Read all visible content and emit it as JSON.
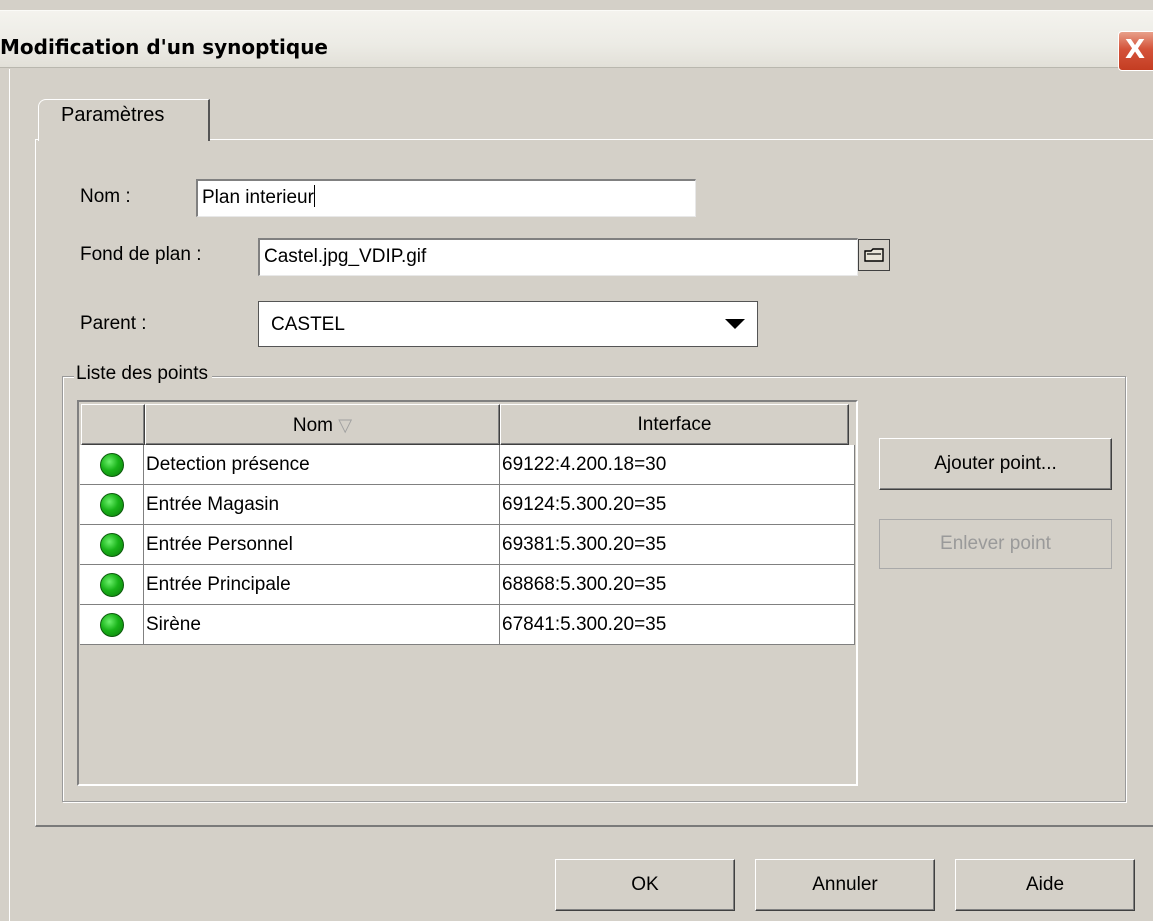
{
  "window": {
    "title": "Modification d'un synoptique",
    "close_glyph": "X"
  },
  "tabs": [
    {
      "label": "Paramètres",
      "selected": true
    }
  ],
  "form": {
    "nom_label": "Nom :",
    "nom_value": "Plan interieur",
    "fond_label": "Fond de plan :",
    "fond_value": "Castel.jpg_VDIP.gif",
    "parent_label": "Parent :",
    "parent_value": "CASTEL"
  },
  "points": {
    "group_title": "Liste des points",
    "columns": {
      "nom": "Nom",
      "sort_glyph": "▽",
      "interface": "Interface"
    },
    "rows": [
      {
        "status": "green",
        "nom": "Detection présence",
        "interface": "69122:4.200.18=30"
      },
      {
        "status": "green",
        "nom": "Entrée Magasin",
        "interface": "69124:5.300.20=35"
      },
      {
        "status": "green",
        "nom": "Entrée Personnel",
        "interface": "69381:5.300.20=35"
      },
      {
        "status": "green",
        "nom": "Entrée Principale",
        "interface": "68868:5.300.20=35"
      },
      {
        "status": "green",
        "nom": "Sirène",
        "interface": "67841:5.300.20=35"
      }
    ],
    "add_button": "Ajouter point...",
    "remove_button": "Enlever point"
  },
  "footer": {
    "ok": "OK",
    "cancel": "Annuler",
    "help": "Aide"
  },
  "colors": {
    "dialog_bg": "#d4d0c8",
    "status_green": "#19b319",
    "close_red": "#d4533a"
  },
  "icons": {
    "browse": "folder-icon",
    "combo_arrow": "chevron-down-icon",
    "sort": "sort-desc-icon"
  }
}
